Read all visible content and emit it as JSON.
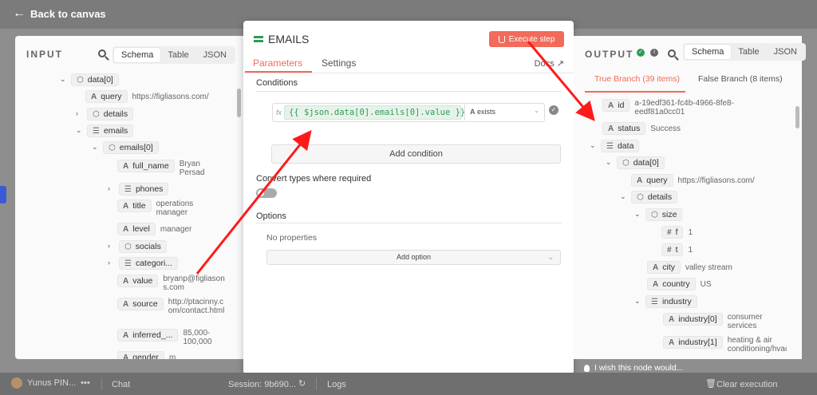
{
  "topbar": {
    "back_label": "Back to canvas"
  },
  "input": {
    "title": "INPUT",
    "tabs": [
      "Schema",
      "Table",
      "JSON"
    ],
    "tree": {
      "data0": "data[0]",
      "query_key": "query",
      "query_val": "https://figliasons.com/",
      "details": "details",
      "emails": "emails",
      "emails0": "emails[0]",
      "full_name_key": "full_name",
      "full_name_val": "Bryan Persad",
      "phones": "phones",
      "title_key": "title",
      "title_val": "operations manager",
      "level_key": "level",
      "level_val": "manager",
      "socials": "socials",
      "categori": "categori...",
      "value_key": "value",
      "value_val": "bryanp@figliasons.com",
      "source_key": "source",
      "source_val": "http://ptacinny.com/contact.html",
      "inferred_key": "inferred_...",
      "inferred_val": "85,000-100,000",
      "gender_key": "gender",
      "gender_val": "m"
    }
  },
  "modal": {
    "title": "EMAILS",
    "execute_label": "Execute step",
    "tabs": {
      "parameters": "Parameters",
      "settings": "Settings"
    },
    "docs_label": "Docs",
    "conditions_label": "Conditions",
    "expression": "{{ $json.data[0].emails[0].value }}",
    "operator_label": "exists",
    "add_condition_label": "Add condition",
    "convert_label": "Convert types where required",
    "options_label": "Options",
    "no_properties": "No properties",
    "add_option_label": "Add option"
  },
  "output": {
    "title": "OUTPUT",
    "tabs": [
      "Schema",
      "Table",
      "JSON"
    ],
    "true_branch": "True Branch (39 items)",
    "false_branch": "False Branch (8 items)",
    "tree": {
      "id_key": "id",
      "id_val": "a-19edf361-fc4b-4966-8fe8-eedf81a0cc01",
      "status_key": "status",
      "status_val": "Success",
      "data": "data",
      "data0": "data[0]",
      "query_key": "query",
      "query_val": "https://figliasons.com/",
      "details": "details",
      "size": "size",
      "f_key": "f",
      "f_val": "1",
      "t_key": "t",
      "t_val": "1",
      "city_key": "city",
      "city_val": "valley stream",
      "country_key": "country",
      "country_val": "US",
      "industry": "industry",
      "industry0_key": "industry[0]",
      "industry0_val": "consumer services",
      "industry1_key": "industry[1]",
      "industry1_val": "heating & air conditioning/hvac"
    }
  },
  "footer": {
    "user": "Yunus PIN...",
    "chat": "Chat",
    "session": "Session: 9b690...",
    "logs": "Logs",
    "clear": "Clear execution",
    "wish": "I wish this node would..."
  },
  "colors": {
    "accent": "#f26a5a",
    "expression_green": "#2e9b55",
    "status_success": "#2e9b55"
  }
}
